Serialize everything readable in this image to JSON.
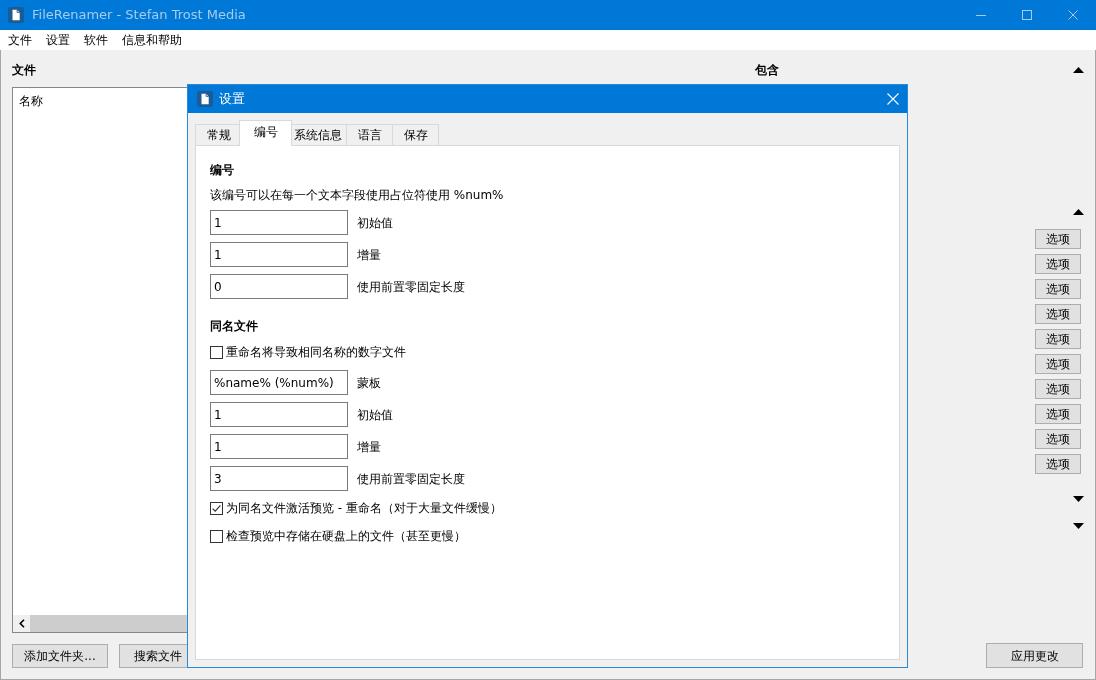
{
  "main_window": {
    "title": "FileRenamer - Stefan Trost Media",
    "focused": false
  },
  "menu": [
    "文件",
    "设置",
    "软件",
    "信息和帮助"
  ],
  "files_panel": {
    "heading": "文件",
    "list_header": "名称",
    "buttons": [
      "添加文件夹...",
      "搜索文件"
    ]
  },
  "include_panel": {
    "heading": "包含",
    "option_buttons": [
      "选项",
      "选项",
      "选项",
      "选项",
      "选项",
      "选项",
      "选项",
      "选项",
      "选项",
      "选项"
    ]
  },
  "apply_button": "应用更改",
  "settings_dialog": {
    "title": "设置",
    "tabs": [
      {
        "label": "常规",
        "selected": false
      },
      {
        "label": "编号",
        "selected": true
      },
      {
        "label": "系统信息",
        "selected": false
      },
      {
        "label": "语言",
        "selected": false
      },
      {
        "label": "保存",
        "selected": false
      }
    ],
    "numbering": {
      "heading": "编号",
      "description": "该编号可以在每一个文本字段使用占位符使用 %num%",
      "fields": [
        {
          "value": "1",
          "label": "初始值"
        },
        {
          "value": "1",
          "label": "增量"
        },
        {
          "value": "0",
          "label": "使用前置零固定长度"
        }
      ]
    },
    "duplicates": {
      "heading": "同名文件",
      "rows": [
        {
          "kind": "checkbox",
          "text": "重命名将导致相同名称的数字文件",
          "checked": false
        },
        {
          "kind": "field",
          "value": "%name% (%num%)",
          "label": "蒙板"
        },
        {
          "kind": "field",
          "value": "1",
          "label": "初始值"
        },
        {
          "kind": "field",
          "value": "1",
          "label": "增量"
        },
        {
          "kind": "field",
          "value": "3",
          "label": "使用前置零固定长度"
        },
        {
          "kind": "checkbox",
          "text": "为同名文件激活预览 - 重命名（对于大量文件缓慢）",
          "checked": true
        },
        {
          "kind": "checkbox",
          "text": "检查预览中存储在硬盘上的文件（甚至更慢）",
          "checked": false
        }
      ]
    }
  }
}
